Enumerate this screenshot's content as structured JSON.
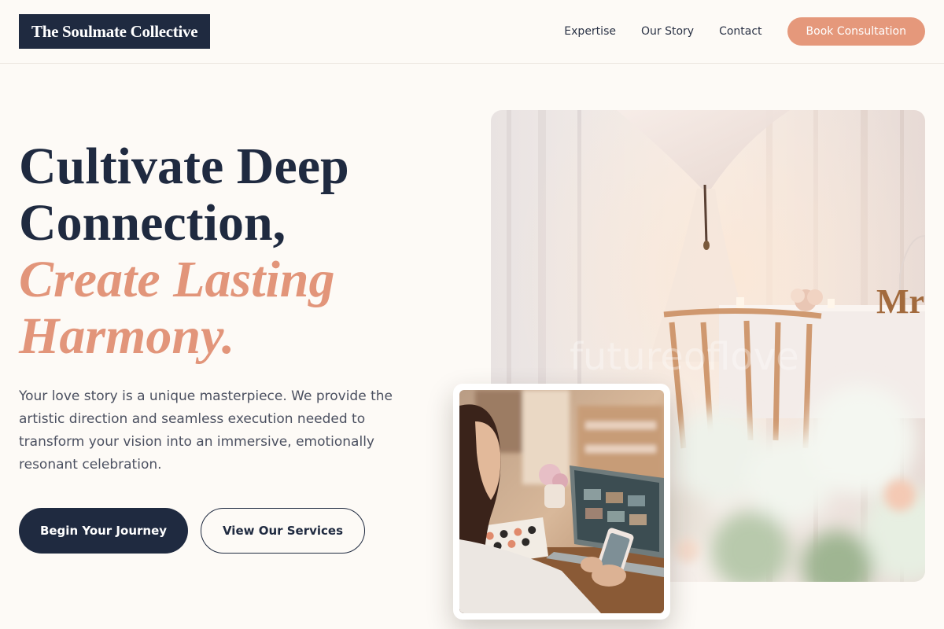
{
  "header": {
    "logo": "The Soulmate Collective",
    "nav": [
      "Expertise",
      "Our Story",
      "Contact"
    ],
    "cta": "Book Consultation"
  },
  "hero": {
    "headline_line1": "Cultivate Deep",
    "headline_line2": "Connection,",
    "headline_accent1": "Create Lasting",
    "headline_accent2": "Harmony.",
    "description": "Your love story is a unique masterpiece. We provide the artistic direction and seamless execution needed to transform your vision into an immersive, emotionally resonant celebration.",
    "primary_button": "Begin Your Journey",
    "secondary_button": "View Our Services"
  },
  "images": {
    "main_watermark": "futureoflove",
    "main_sign": "Mr"
  },
  "colors": {
    "navy": "#1f2a40",
    "accent": "#e5987b",
    "background": "#fdfaf6"
  }
}
